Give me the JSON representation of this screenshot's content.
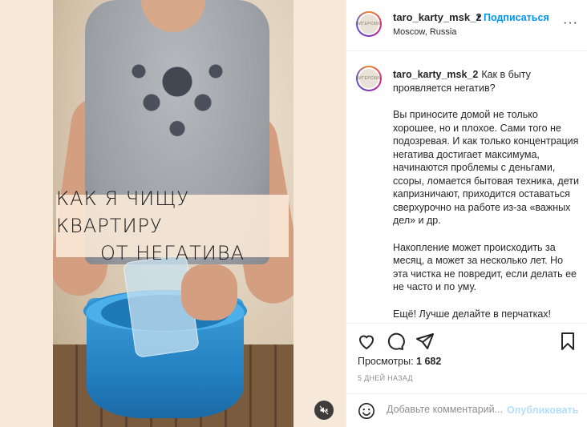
{
  "post": {
    "username": "taro_karty_msk_2",
    "follow_dot": "•",
    "follow_label": "Подписаться",
    "location": "Moscow, Russia",
    "more_label": "···",
    "avatar_text": "ПИТЕРСКИЕ"
  },
  "media": {
    "overlay_line1": "Как я чищу квартиру",
    "overlay_line2": "от негатива",
    "muted": true
  },
  "caption": {
    "username": "taro_karty_msk_2",
    "intro": "Как в быту проявляется негатив?",
    "paragraph1": "Вы приносите домой не только хорошее, но и плохое. Сами того не подозревая. И как только концентрация негатива достигает максимума, начинаются проблемы с деньгами, ссоры, ломается бытовая техника, дети капризничают, приходится оставаться сверхурочно на работе из-за «важных дел» и др.",
    "paragraph2": "Накопление может происходить за месяц, а может за несколько лет. Но эта чистка не повредит, если делать ее не часто и по уму.",
    "paragraph3": "Ещё! Лучше делайте в перчатках!"
  },
  "actions": {
    "views_label": "Просмотры:",
    "views_count": "1 682",
    "date": "5 дней назад"
  },
  "comment_box": {
    "placeholder": "Добавьте комментарий...",
    "publish_label": "Опубликовать"
  },
  "colors": {
    "accent": "#0095f6",
    "publish_disabled": "#b2dffc",
    "secondary_text": "#8e8e8e",
    "border": "#efefef"
  }
}
